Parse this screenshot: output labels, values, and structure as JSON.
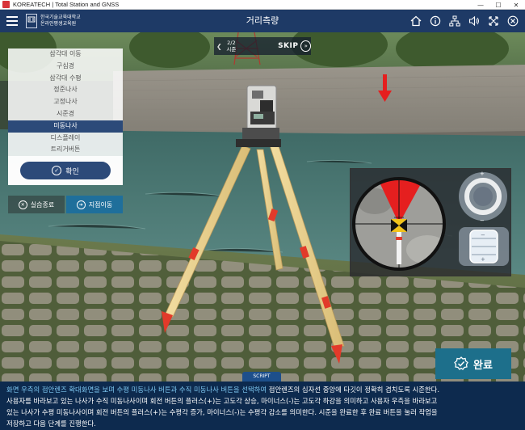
{
  "window": {
    "title": "KOREATECH | Total Station and GNSS",
    "controls": [
      "—",
      "☐",
      "✕"
    ]
  },
  "header": {
    "logo_line1": "한국기술교육대학교",
    "logo_line2": "온라인평생교육원",
    "logo_mark": "KOREATECH",
    "logo_sub": "OLEI",
    "title": "거리측량",
    "icons": [
      "home-icon",
      "info-icon",
      "sitemap-icon",
      "sound-icon",
      "fullscreen-icon",
      "close-icon"
    ]
  },
  "step": {
    "current": "2/2",
    "label": "시준",
    "skip_label": "SKIP"
  },
  "left_menu": {
    "items": [
      "삼각대 이동",
      "구심경",
      "삼각대 수평",
      "정준나사",
      "고정나사",
      "시준경",
      "미동나사",
      "디스플레이",
      "트리거버튼"
    ],
    "active_index": 6,
    "confirm_label": "확인"
  },
  "actions": {
    "exit_label": "실습종료",
    "move_label": "지점이동"
  },
  "complete_label": "완료",
  "script": {
    "tab_label": "SCRIPT",
    "highlight": "화면 우측의 접안렌즈 확대화면을 보며 수평 미동나사 버튼과 수직 미동나사 버튼을 선택하여",
    "line1_rest": " 접안렌즈의 십자선 중앙에 타깃이 정확히 겹치도록 시준한다.",
    "line2": "사용자를 바라보고 있는 나사가 수직 미동나사이며 회전 버튼의 플러스(+)는 고도각 상승, 마이너스(-)는 고도각 하강을 의미하고 사용자 우측을 바라보고",
    "line3": "있는 나사가 수평 미동나사이며 회전 버튼의 플러스(+)는 수평각 증가, 마이너스(-)는 수평각 감소를 의미한다. 시준을 완료한 후 완료 버튼을 눌러 작업을",
    "line4": "저장하고 다음 단계를 진행한다."
  },
  "colors": {
    "header": "#1e3a66",
    "menu_active": "#2c4a79",
    "move_button": "#1f6f9b",
    "complete_button": "#1d6f8b",
    "script_bg": "#0d2a4e",
    "script_highlight": "#7ec8f2",
    "marker_red": "#e51f1f"
  }
}
